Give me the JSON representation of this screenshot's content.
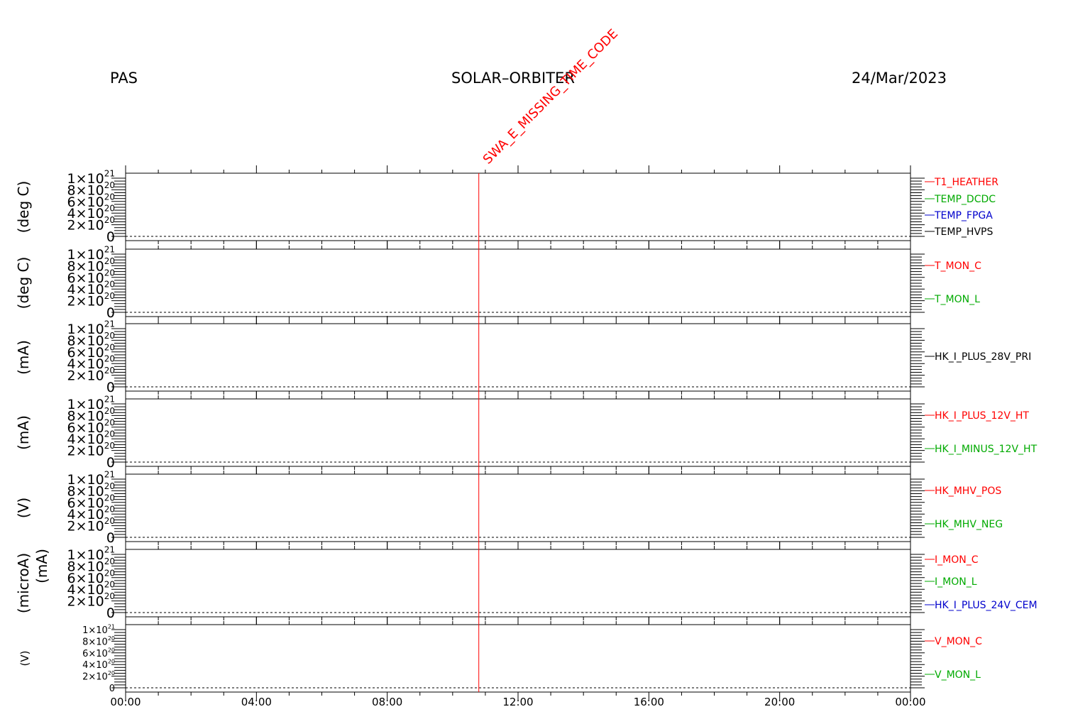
{
  "header": {
    "instrument": "PAS",
    "mission": "SOLAR–ORBITER",
    "date": "24/Mar/2023"
  },
  "event_marker": {
    "label": "SWA_E_MISSING_TIME_CODE",
    "time": "10:48",
    "color": "#ff0000"
  },
  "chart_data": {
    "type": "line",
    "x_axis": {
      "range": [
        "00:00",
        "24:00"
      ],
      "tick_labels": [
        "00:00",
        "04:00",
        "08:00",
        "12:00",
        "16:00",
        "20:00",
        "00:00"
      ],
      "minor_ticks_per_major": 4
    },
    "y_axis": {
      "range": [
        0,
        1e+21
      ],
      "tick_labels": [
        {
          "mant": "0",
          "exp": ""
        },
        {
          "mant": "2×10",
          "exp": "20"
        },
        {
          "mant": "4×10",
          "exp": "20"
        },
        {
          "mant": "6×10",
          "exp": "20"
        },
        {
          "mant": "8×10",
          "exp": "20"
        },
        {
          "mant": "1×10",
          "exp": "21"
        }
      ],
      "zero_line": "dotted"
    },
    "panels": [
      {
        "ylabel": "(deg C)",
        "series": [
          {
            "name": "T1_HEATHER",
            "color": "#ff0000",
            "values": []
          },
          {
            "name": "TEMP_DCDC",
            "color": "#00aa00",
            "values": []
          },
          {
            "name": "TEMP_FPGA",
            "color": "#0000cc",
            "values": []
          },
          {
            "name": "TEMP_HVPS",
            "color": "#000000",
            "values": []
          }
        ]
      },
      {
        "ylabel": "(deg C)",
        "series": [
          {
            "name": "T_MON_C",
            "color": "#ff0000",
            "values": []
          },
          {
            "name": "T_MON_L",
            "color": "#00aa00",
            "values": []
          }
        ]
      },
      {
        "ylabel": "(mA)",
        "series": [
          {
            "name": "HK_I_PLUS_28V_PRI",
            "color": "#000000",
            "values": []
          }
        ]
      },
      {
        "ylabel": "(mA)",
        "series": [
          {
            "name": "HK_I_PLUS_12V_HT",
            "color": "#ff0000",
            "values": []
          },
          {
            "name": "HK_I_MINUS_12V_HT",
            "color": "#00aa00",
            "values": []
          }
        ]
      },
      {
        "ylabel": "(V)",
        "series": [
          {
            "name": "HK_MHV_POS",
            "color": "#ff0000",
            "values": []
          },
          {
            "name": "HK_MHV_NEG",
            "color": "#00aa00",
            "values": []
          }
        ]
      },
      {
        "ylabel": "(microA)",
        "ylabel2": "(mA)",
        "series": [
          {
            "name": "I_MON_C",
            "color": "#ff0000",
            "values": []
          },
          {
            "name": "I_MON_L",
            "color": "#00aa00",
            "values": []
          },
          {
            "name": "HK_I_PLUS_24V_CEM",
            "color": "#0000cc",
            "values": []
          }
        ]
      },
      {
        "ylabel": "(V)",
        "series": [
          {
            "name": "V_MON_C",
            "color": "#ff0000",
            "values": []
          },
          {
            "name": "V_MON_L",
            "color": "#00aa00",
            "values": []
          }
        ]
      }
    ]
  }
}
